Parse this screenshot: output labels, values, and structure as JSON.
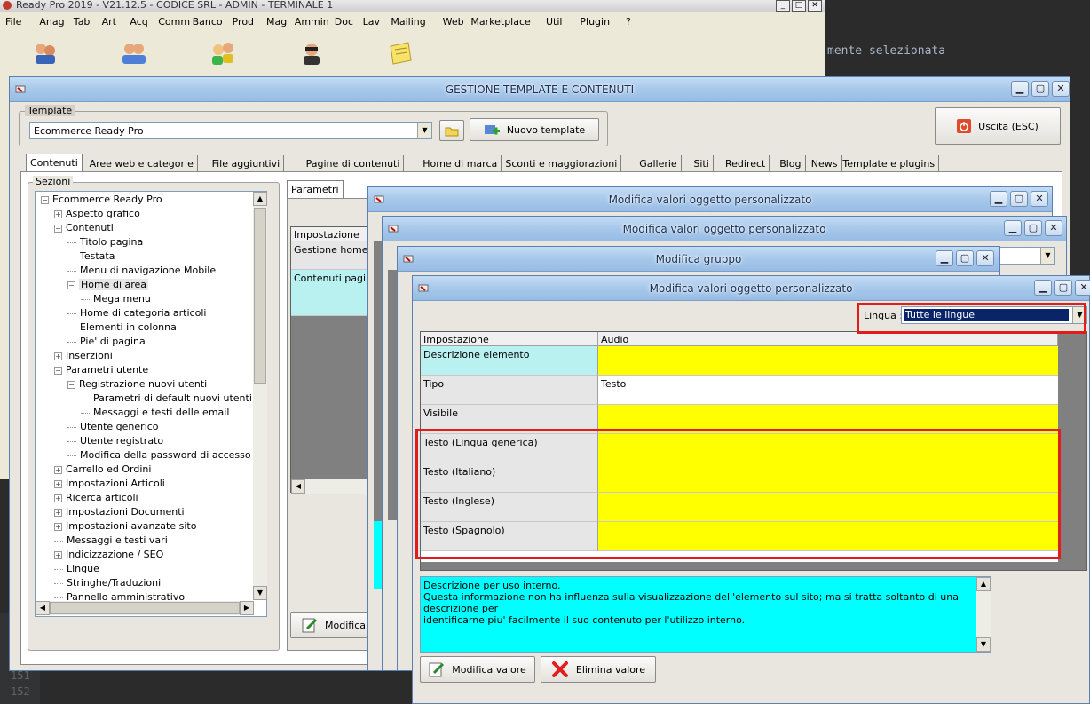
{
  "background_editor": {
    "code_fragment": "mente selezionata",
    "line_numbers": [
      "151",
      "152"
    ]
  },
  "main_app": {
    "title": "Ready Pro 2019 - V21.12.5 - CODICE SRL - ADMIN - TERMINALE 1",
    "menu": [
      "File",
      "Anag",
      "Tab",
      "Art",
      "Acq",
      "Comm",
      "Banco",
      "Prod",
      "Mag",
      "Ammin",
      "Doc",
      "Lav",
      "Mailing",
      "Web",
      "Marketplace",
      "Util",
      "Plugin",
      "?"
    ]
  },
  "template_window": {
    "title": "GESTIONE TEMPLATE E CONTENUTI",
    "template_group_label": "Template",
    "template_value": "Ecommerce Ready Pro",
    "new_template_label": "Nuovo template",
    "exit_label": "Uscita (ESC)",
    "tabs": [
      "Contenuti",
      "Aree web e categorie",
      "File aggiuntivi",
      "Pagine di contenuti",
      "Home di marca",
      "Sconti e maggiorazioni",
      "Gallerie",
      "Siti",
      "Redirect",
      "Blog",
      "News",
      "Template e plugins"
    ],
    "sections_label": "Sezioni",
    "tree": [
      {
        "label": "Ecommerce Ready Pro",
        "level": 0,
        "exp": "-"
      },
      {
        "label": "Aspetto grafico",
        "level": 1,
        "exp": "+"
      },
      {
        "label": "Contenuti",
        "level": 1,
        "exp": "-"
      },
      {
        "label": "Titolo pagina",
        "level": 2,
        "exp": ""
      },
      {
        "label": "Testata",
        "level": 2,
        "exp": ""
      },
      {
        "label": "Menu di navigazione Mobile",
        "level": 2,
        "exp": ""
      },
      {
        "label": "Home di area",
        "level": 2,
        "exp": "-",
        "selected": true
      },
      {
        "label": "Mega menu",
        "level": 3,
        "exp": ""
      },
      {
        "label": "Home di categoria articoli",
        "level": 2,
        "exp": ""
      },
      {
        "label": "Elementi in colonna",
        "level": 2,
        "exp": ""
      },
      {
        "label": "Pie' di pagina",
        "level": 2,
        "exp": ""
      },
      {
        "label": "Inserzioni",
        "level": 1,
        "exp": "+"
      },
      {
        "label": "Parametri utente",
        "level": 1,
        "exp": "-"
      },
      {
        "label": "Registrazione nuovi utenti",
        "level": 2,
        "exp": "-"
      },
      {
        "label": "Parametri di default nuovi utenti",
        "level": 3,
        "exp": ""
      },
      {
        "label": "Messaggi e testi delle email",
        "level": 3,
        "exp": ""
      },
      {
        "label": "Utente generico",
        "level": 2,
        "exp": ""
      },
      {
        "label": "Utente registrato",
        "level": 2,
        "exp": ""
      },
      {
        "label": "Modifica della password di accesso",
        "level": 2,
        "exp": ""
      },
      {
        "label": "Carrello ed Ordini",
        "level": 1,
        "exp": "+"
      },
      {
        "label": "Impostazioni Articoli",
        "level": 1,
        "exp": "+"
      },
      {
        "label": "Ricerca articoli",
        "level": 1,
        "exp": "+"
      },
      {
        "label": "Impostazioni Documenti",
        "level": 1,
        "exp": "+"
      },
      {
        "label": "Impostazioni avanzate sito",
        "level": 1,
        "exp": "+"
      },
      {
        "label": "Messaggi e testi vari",
        "level": 1,
        "exp": ""
      },
      {
        "label": "Indicizzazione / SEO",
        "level": 1,
        "exp": "+"
      },
      {
        "label": "Lingue",
        "level": 1,
        "exp": ""
      },
      {
        "label": "Stringhe/Traduzioni",
        "level": 1,
        "exp": ""
      },
      {
        "label": "Pannello amministrativo",
        "level": 1,
        "exp": ""
      }
    ],
    "params_tab": "Parametri",
    "params_header": "Impostazione",
    "params_rows": [
      "Gestione home pa",
      "Contenuti pagina"
    ],
    "modify_label": "Modifica"
  },
  "dialog1": {
    "title": "Modifica valori oggetto personalizzato"
  },
  "dialog2": {
    "title": "Modifica valori oggetto personalizzato"
  },
  "dialog3": {
    "title": "Modifica gruppo"
  },
  "dialog4": {
    "title": "Modifica valori oggetto personalizzato",
    "lingua_label": "Lingua :",
    "lingua_value": "Tutte le lingue",
    "col_setting": "Impostazione",
    "col_value": "Audio",
    "rows": [
      {
        "setting": "Descrizione elemento",
        "value": "",
        "setting_bg": "#b9f1f1",
        "value_bg": "#ffff00"
      },
      {
        "setting": "Tipo",
        "value": "Testo",
        "setting_bg": "#e6e6e6",
        "value_bg": "#ffffff"
      },
      {
        "setting": "Visibile",
        "value": "",
        "setting_bg": "#e6e6e6",
        "value_bg": "#ffff00"
      },
      {
        "setting": "Testo (Lingua generica)",
        "value": "",
        "setting_bg": "#e6e6e6",
        "value_bg": "#ffff00"
      },
      {
        "setting": "Testo (Italiano)",
        "value": "",
        "setting_bg": "#e6e6e6",
        "value_bg": "#ffff00"
      },
      {
        "setting": "Testo (Inglese)",
        "value": "",
        "setting_bg": "#e6e6e6",
        "value_bg": "#ffff00"
      },
      {
        "setting": "Testo (Spagnolo)",
        "value": "",
        "setting_bg": "#e6e6e6",
        "value_bg": "#ffff00"
      }
    ],
    "description_lines": [
      "Descrizione per uso interno.",
      "Questa informazione non ha influenza sulla visualizzazione dell'elemento sul sito; ma si tratta soltanto di una descrizione per",
      "identificarne piu' facilmente il suo contenuto per l'utilizzo interno."
    ],
    "modify_value_label": "Modifica valore",
    "delete_value_label": "Elimina valore"
  },
  "colors": {
    "highlight_red": "#e21b1b",
    "yellow": "#ffff00",
    "cyan": "#00ffff",
    "selection": "#0a246a"
  }
}
